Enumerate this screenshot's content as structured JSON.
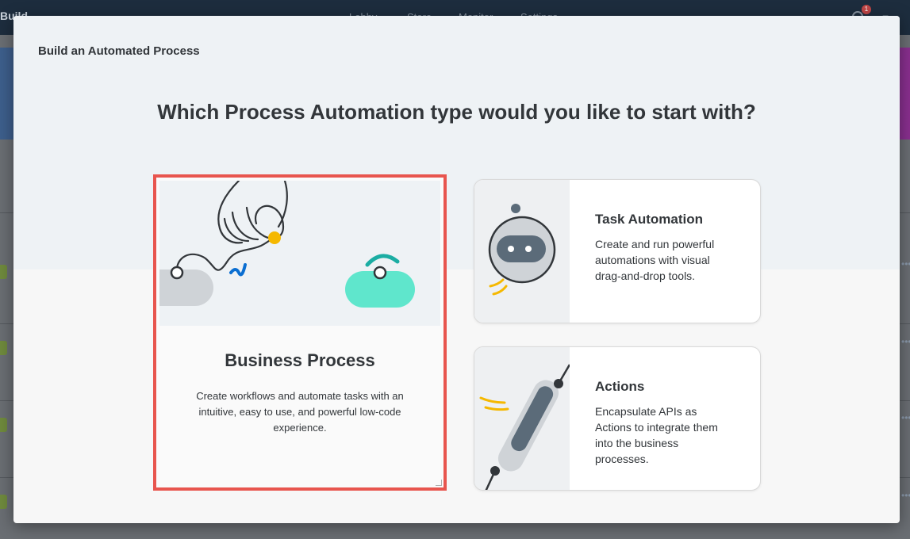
{
  "background": {
    "app_title": "Build",
    "nav": [
      "Lobby",
      "Store",
      "Monitor",
      "Settings"
    ],
    "notification_count": "1"
  },
  "dialog": {
    "title": "Build an Automated Process",
    "question": "Which Process Automation type would you like to start with?",
    "options": [
      {
        "title": "Business Process",
        "description": "Create workflows and automate tasks with an intuitive, easy to use, and powerful low-code experience.",
        "icon": "hand-drawing-flow-illustration",
        "selected": true
      },
      {
        "title": "Task Automation",
        "description": "Create and run powerful automations with visual drag-and-drop tools.",
        "icon": "robot-illustration"
      },
      {
        "title": "Actions",
        "description": "Encapsulate APIs as Actions to integrate them into the business processes.",
        "icon": "cable-plug-illustration"
      }
    ]
  },
  "colors": {
    "selection_border": "#e8554e",
    "accent_mint": "#5fe6cc",
    "accent_yellow": "#f5b800",
    "accent_blue": "#0a6ed1",
    "dialog_bg": "#f7f7f7"
  }
}
